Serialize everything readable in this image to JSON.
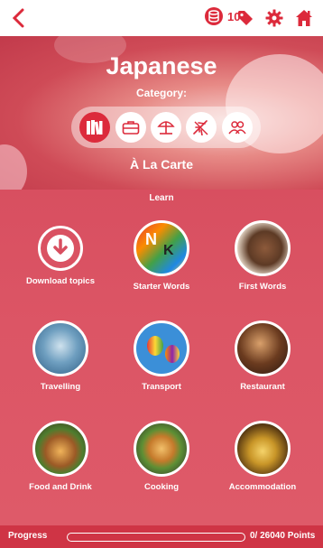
{
  "header": {
    "coin_badge": "10",
    "coin_count": "10"
  },
  "banner": {
    "language": "Japanese",
    "category_label": "Category:",
    "selected_category": "À La Carte",
    "categories": [
      {
        "icon": "books-icon",
        "active": true
      },
      {
        "icon": "briefcase-icon",
        "active": false
      },
      {
        "icon": "beach-umbrella-icon",
        "active": false
      },
      {
        "icon": "airplane-icon",
        "active": false
      },
      {
        "icon": "people-icon",
        "active": false
      }
    ]
  },
  "main": {
    "section_label": "Learn",
    "tiles": [
      {
        "label": "Download topics",
        "icon": "download-icon"
      },
      {
        "label": "Starter Words",
        "icon": "letter-blocks-image"
      },
      {
        "label": "First Words",
        "icon": "baby-image"
      },
      {
        "label": "Travelling",
        "icon": "compass-map-image"
      },
      {
        "label": "Transport",
        "icon": "hot-air-balloons-image"
      },
      {
        "label": "Restaurant",
        "icon": "waiter-wine-image"
      },
      {
        "label": "Food and Drink",
        "icon": "burger-image"
      },
      {
        "label": "Cooking",
        "icon": "cooked-dish-image"
      },
      {
        "label": "Accommodation",
        "icon": "service-bell-image"
      }
    ]
  },
  "progress": {
    "label": "Progress",
    "points_text": "0/ 26040 Points",
    "fraction": 0
  },
  "colors": {
    "accent": "#dc2a3b",
    "main_bg": "#d84f60"
  }
}
